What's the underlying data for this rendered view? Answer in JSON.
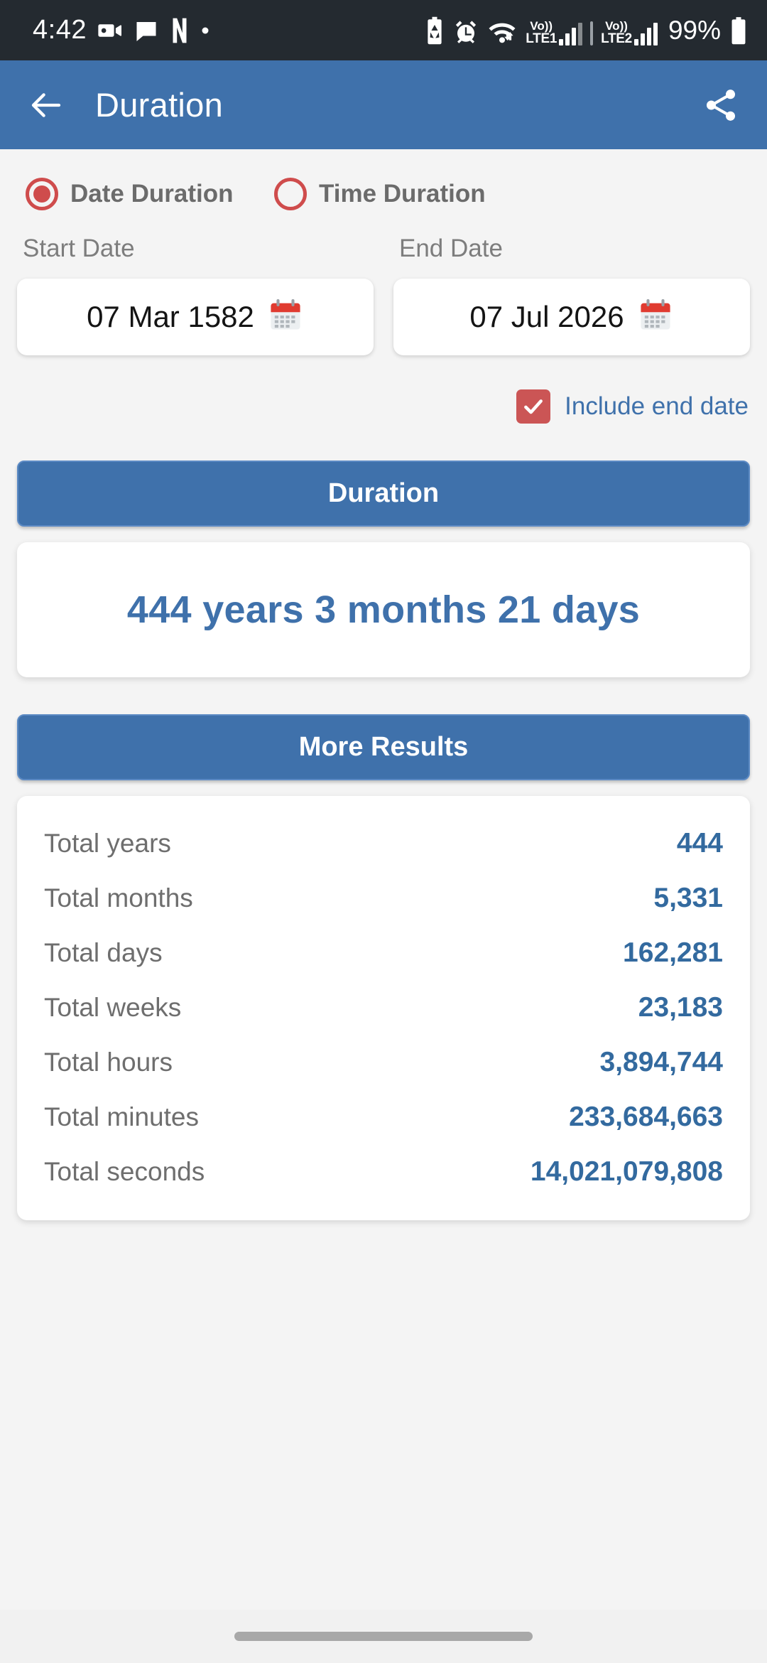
{
  "status_bar": {
    "time": "4:42",
    "battery_percent": "99%",
    "left_icons": [
      "video-camera-icon",
      "chat-bubble-icon",
      "netflix-icon",
      "dot-icon"
    ],
    "right_icons": [
      "battery-saver-icon",
      "alarm-icon",
      "wifi-icon"
    ],
    "sim1": {
      "volte_top": "Vo))",
      "volte_bottom": "LTE1"
    },
    "sim2": {
      "volte_top": "Vo))",
      "volte_bottom": "LTE2"
    }
  },
  "app_bar": {
    "title": "Duration",
    "back_icon": "back-arrow-icon",
    "share_icon": "share-icon"
  },
  "mode_options": [
    {
      "label": "Date Duration",
      "selected": true
    },
    {
      "label": "Time Duration",
      "selected": false
    }
  ],
  "inputs": {
    "start": {
      "label": "Start Date",
      "value": "07 Mar 1582",
      "icon": "calendar-icon"
    },
    "end": {
      "label": "End Date",
      "value": "07 Jul 2026",
      "icon": "calendar-icon"
    },
    "include_end_date": {
      "label": "Include end date",
      "checked": true
    }
  },
  "duration_section": {
    "header": "Duration",
    "result": "444 years 3 months 21 days"
  },
  "more_results_section": {
    "header": "More Results",
    "rows": [
      {
        "label": "Total years",
        "value": "444"
      },
      {
        "label": "Total months",
        "value": "5,331"
      },
      {
        "label": "Total days",
        "value": "162,281"
      },
      {
        "label": "Total weeks",
        "value": "23,183"
      },
      {
        "label": "Total hours",
        "value": "3,894,744"
      },
      {
        "label": "Total minutes",
        "value": "233,684,663"
      },
      {
        "label": "Total seconds",
        "value": "14,021,079,808"
      }
    ]
  },
  "colors": {
    "primary_blue": "#3f71ab",
    "value_blue": "#336a9f",
    "accent_red": "#cb5555",
    "radio_red": "#cf4c4c",
    "status_bar_bg": "#242a30",
    "page_bg": "#f4f4f4"
  }
}
